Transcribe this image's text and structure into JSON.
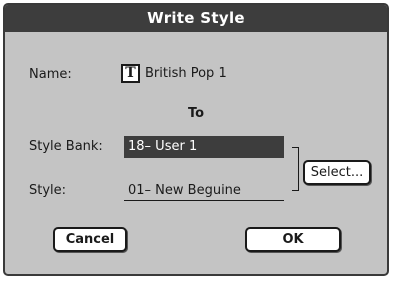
{
  "dialog": {
    "title": "Write Style",
    "name_label": "Name:",
    "name_edit_icon": "T",
    "name_value": "British Pop 1",
    "to_label": "To",
    "style_bank_label": "Style Bank:",
    "style_bank_value": "18– User 1",
    "style_label": "Style:",
    "style_value": "01– New Beguine",
    "select_button": "Select...",
    "cancel_button": "Cancel",
    "ok_button": "OK"
  },
  "colors": {
    "title_bar": "#3d3d3d",
    "dialog_background": "#c4c4c4",
    "selected_field": "#3d3d3d",
    "button_face": "#ffffff"
  }
}
